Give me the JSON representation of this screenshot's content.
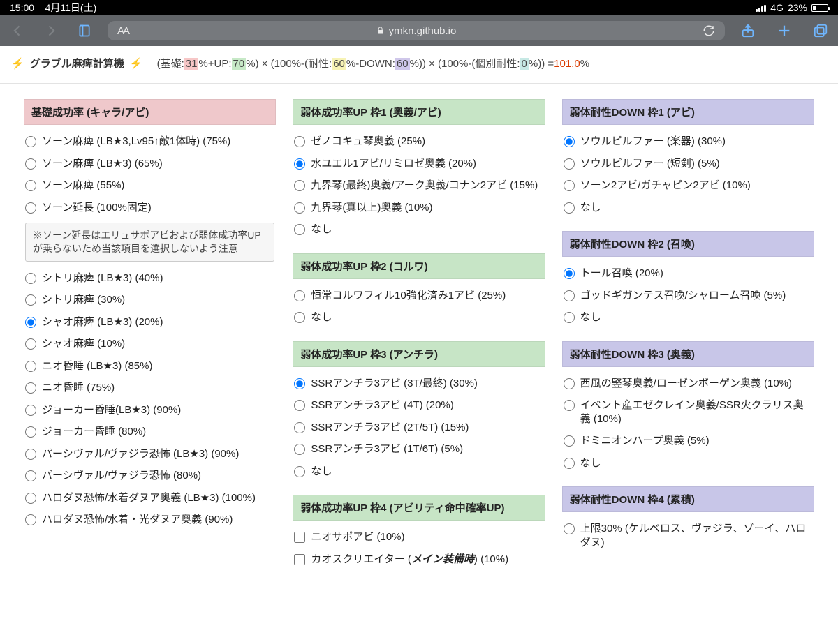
{
  "status": {
    "time": "15:00",
    "date": "4月11日(土)",
    "net": "4G",
    "battery_pct": "23%",
    "battery_fill_width": "23%"
  },
  "nav": {
    "url_host": "ymkn.github.io",
    "aA": "AA"
  },
  "formula": {
    "emoji": "⚡",
    "title": "グラブル麻痺計算機",
    "base_label": "基礎:",
    "base_val": "31",
    "up_label": "+UP:",
    "up_val": "70",
    "res_label": "耐性:",
    "res_val": "60",
    "down_label": "-DOWN:",
    "down_val": "60",
    "indiv_label": "個別耐性:",
    "indiv_val": "0",
    "paren1a": "(",
    "paren1b": "%",
    "paren1c": "%) ×",
    "paren2a": "(100%-(",
    "paren2b": "%",
    "paren2c": "%)) ×",
    "paren3a": "(100%-(",
    "paren3b": "%)) =",
    "result": "101.0",
    "result_suffix": "%"
  },
  "col1": {
    "sec": "基礎成功率 (キャラ/アビ)",
    "items": [
      "ソーン麻痺 (LB★3,Lv95↑敵1体時) (75%)",
      "ソーン麻痺 (LB★3) (65%)",
      "ソーン麻痺 (55%)",
      "ソーン延長 (100%固定)"
    ],
    "note": "※ソーン延長はエリュサポアビおよび弱体成功率UPが乗らないため当該項目を選択しないよう注意",
    "items2": [
      "シトリ麻痺 (LB★3) (40%)",
      "シトリ麻痺 (30%)",
      "シャオ麻痺 (LB★3) (20%)",
      "シャオ麻痺 (10%)",
      "ニオ昏睡 (LB★3) (85%)",
      "ニオ昏睡 (75%)",
      "ジョーカー昏睡(LB★3) (90%)",
      "ジョーカー昏睡 (80%)",
      "パーシヴァル/ヴァジラ恐怖 (LB★3) (90%)",
      "パーシヴァル/ヴァジラ恐怖 (80%)",
      "ハロダヌ恐怖/水着ダヌア奥義 (LB★3) (100%)",
      "ハロダヌ恐怖/水着・光ダヌア奥義 (90%)"
    ],
    "selected_index": 2
  },
  "col2": {
    "sec1": "弱体成功率UP 枠1 (奥義/アビ)",
    "items1": [
      "ゼノコキュ琴奥義 (25%)",
      "水ユエル1アビ/リミロゼ奥義 (20%)",
      "九界琴(最終)奥義/アーク奥義/コナン2アビ (15%)",
      "九界琴(真以上)奥義 (10%)",
      "なし"
    ],
    "sel1": 1,
    "sec2": "弱体成功率UP 枠2 (コルワ)",
    "items2": [
      "恒常コルワフィル10強化済み1アビ (25%)",
      "なし"
    ],
    "sec3": "弱体成功率UP 枠3 (アンチラ)",
    "items3": [
      "SSRアンチラ3アビ (3T/最終) (30%)",
      "SSRアンチラ3アビ (4T) (20%)",
      "SSRアンチラ3アビ (2T/5T) (15%)",
      "SSRアンチラ3アビ (1T/6T) (5%)",
      "なし"
    ],
    "sel3": 0,
    "sec4": "弱体成功率UP 枠4 (アビリティ命中確率UP)",
    "items4": [
      "ニオサポアビ (10%)"
    ],
    "item4_html_prefix": "カオスクリエイター (",
    "item4_html_em": "メイン装備時",
    "item4_html_suffix": ") (10%)"
  },
  "col3": {
    "sec1": "弱体耐性DOWN 枠1 (アビ)",
    "items1": [
      "ソウルピルファー (楽器) (30%)",
      "ソウルピルファー (短剣) (5%)",
      "ソーン2アビ/ガチャピン2アビ (10%)",
      "なし"
    ],
    "sel1": 0,
    "sec2": "弱体耐性DOWN 枠2 (召喚)",
    "items2": [
      "トール召喚 (20%)",
      "ゴッドギガンテス召喚/シャローム召喚 (5%)",
      "なし"
    ],
    "sel2": 0,
    "sec3": "弱体耐性DOWN 枠3 (奥義)",
    "items3": [
      "西風の竪琴奥義/ローゼンボーゲン奥義 (10%)",
      "イベント産エゼクレイン奥義/SSR火クラリス奥義 (10%)",
      "ドミニオンハープ奥義 (5%)",
      "なし"
    ],
    "sec4": "弱体耐性DOWN 枠4 (累積)",
    "items4": [
      "上限30% (ケルベロス、ヴァジラ、ゾーイ、ハロダヌ)"
    ]
  }
}
